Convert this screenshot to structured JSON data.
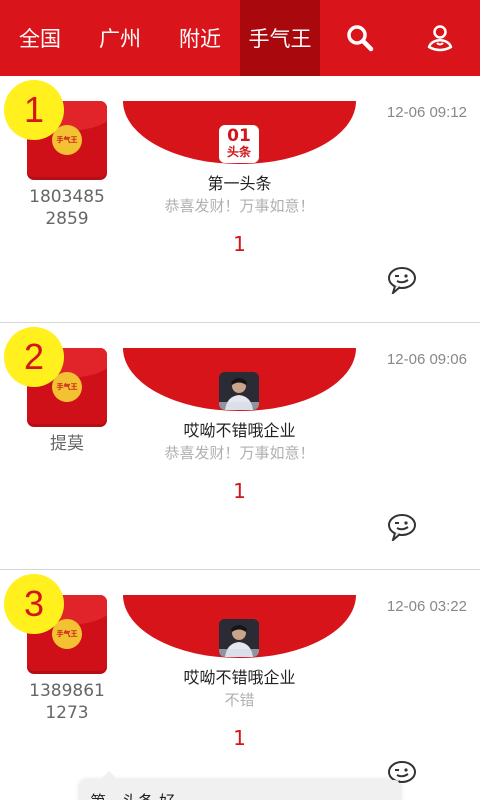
{
  "nav": {
    "tabs": [
      "全国",
      "广州",
      "附近",
      "手气王"
    ],
    "active_index": 3,
    "icons": [
      "search-icon",
      "user-account-icon"
    ]
  },
  "colors": {
    "brand_red": "#d9151b",
    "active_tab": "#a9080d",
    "rank_badge": "#fff01e"
  },
  "envelope_seal_text": "手气王",
  "items": [
    {
      "rank": "1",
      "sender_line1": "1803485",
      "sender_line2": "2859",
      "logo_type": "text",
      "logo_text_top": "01",
      "logo_text_bottom": "头条",
      "title": "第一头条",
      "wish": "恭喜发财！万事如意！",
      "count": "1",
      "time": "12-06 09:12"
    },
    {
      "rank": "2",
      "sender_line1": "提莫",
      "sender_line2": "",
      "logo_type": "avatar",
      "title": "哎呦不错哦企业",
      "wish": "恭喜发财！万事如意！",
      "count": "1",
      "time": "12-06 09:06"
    },
    {
      "rank": "3",
      "sender_line1": "1389861",
      "sender_line2": "1273",
      "logo_type": "avatar",
      "title": "哎呦不错哦企业",
      "wish": "不错",
      "count": "1",
      "time": "12-06 03:22"
    }
  ],
  "tooltip": {
    "text": "第一头条 好"
  }
}
